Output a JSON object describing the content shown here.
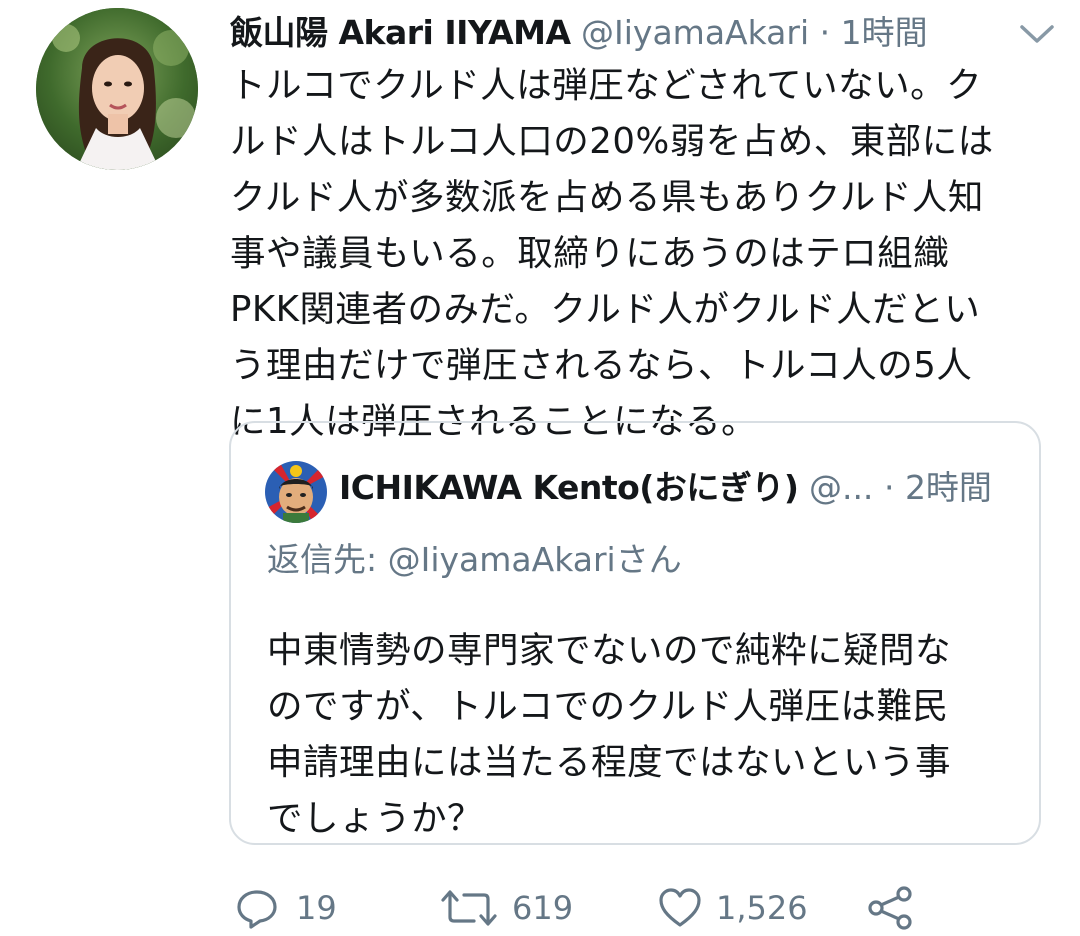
{
  "tweet": {
    "display_name": "飯山陽 Akari IIYAMA",
    "handle": "@IiyamaAkari",
    "separator": "·",
    "time": "1時間",
    "text_lines": [
      "トルコでクルド人は弾圧などされていない。ク",
      "ルド人はトルコ人口の20%弱を占め、東部には",
      "クルド人が多数派を占める県もありクルド人知",
      "事や議員もいる。取締りにあうのはテロ組織",
      "PKK関連者のみだ。クルド人がクルド人だとい",
      "う理由だけで弾圧されるなら、トルコ人の5人",
      "に1人は弾圧されることになる。"
    ],
    "avatar_icon": "profile-photo",
    "menu_icon": "chevron-down-icon"
  },
  "quoted": {
    "display_name": "ICHIKAWA Kento(おにぎり)",
    "handle": "@...",
    "separator": "·",
    "time": "2時間",
    "reply_prefix": "返信先: ",
    "reply_mention": "@IiyamaAkari",
    "reply_suffix": "さん",
    "text_lines": [
      "中東情勢の専門家でないので純粋に疑問な",
      "のですが、トルコでのクルド人弾圧は難民",
      "申請理由には当たる程度ではないという事",
      "でしょうか？"
    ]
  },
  "actions": {
    "reply_count": "19",
    "retweet_count": "619",
    "like_count": "1,526",
    "icons": [
      "reply-icon",
      "retweet-icon",
      "like-icon",
      "share-icon"
    ]
  },
  "colors": {
    "text": "#14171a",
    "secondary": "#657786",
    "border": "#d8dee3"
  }
}
